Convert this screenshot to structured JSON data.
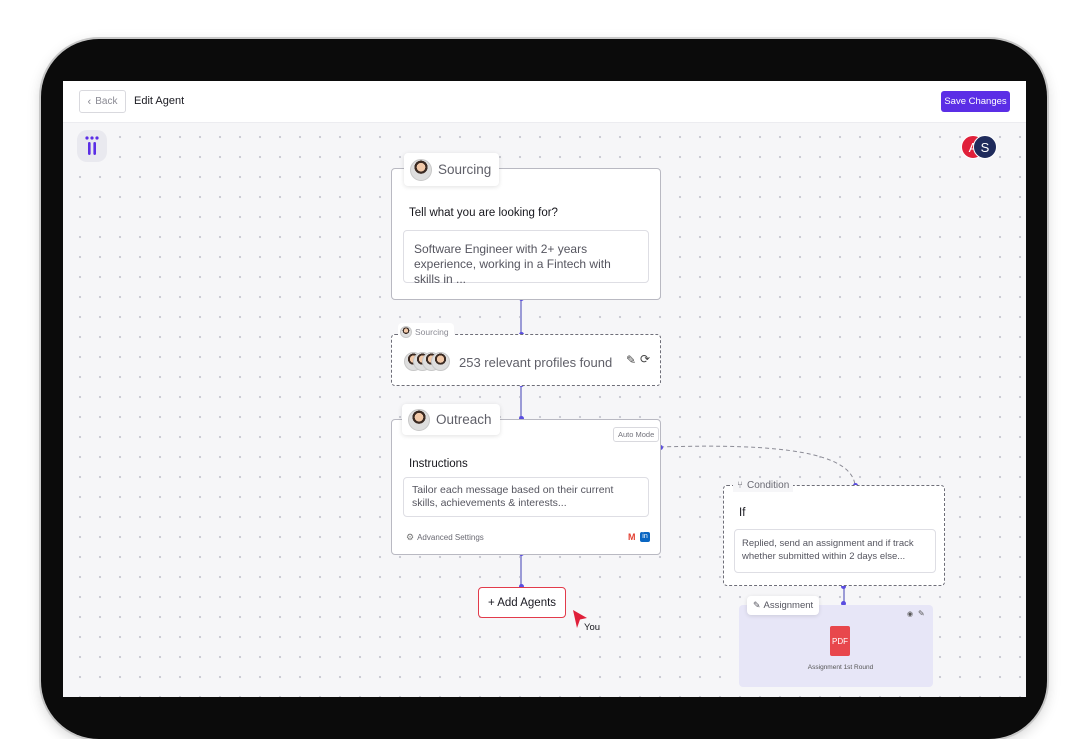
{
  "header": {
    "back_label": "Back",
    "title": "Edit Agent",
    "save_label": "Save Changes"
  },
  "collaborators": [
    "A",
    "S"
  ],
  "sourcing_card": {
    "tab_label": "Sourcing",
    "prompt_label": "Tell what you are looking for?",
    "prompt_value": "Software Engineer with 2+ years experience, working in a Fintech with skills in ..."
  },
  "sourcing_result": {
    "tab_label": "Sourcing",
    "result_text": "253 relevant profiles found"
  },
  "outreach_card": {
    "tab_label": "Outreach",
    "mode_badge": "Auto Mode",
    "instructions_label": "Instructions",
    "instructions_value": "Tailor each message based on their current skills, achievements & interests...",
    "advanced_settings_label": "Advanced Settings"
  },
  "add_agents_label": "+ Add Agents",
  "cursor_label": "You",
  "condition_card": {
    "tab_label": "Condition",
    "if_label": "If",
    "condition_value": "Replied, send an assignment and if track whether submitted within 2 days else..."
  },
  "assignment": {
    "tab_label": "Assignment",
    "file_type": "PDF",
    "file_name": "Assignment 1st Round"
  },
  "colors": {
    "accent": "#5b2ee6",
    "connector": "#5a4de0",
    "add_button_border": "#e23b4b"
  }
}
